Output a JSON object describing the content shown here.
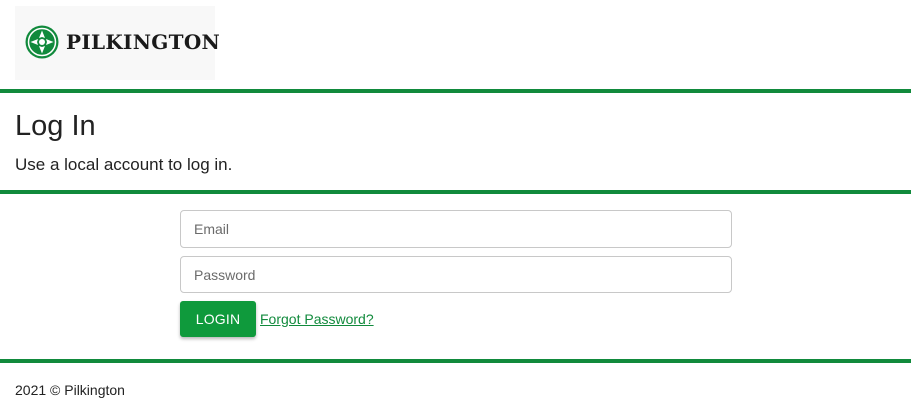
{
  "brand": {
    "name": "PILKINGTON",
    "logo_icon": "pilkington-emblem-icon",
    "accent_color": "#118a3c",
    "button_color": "#0f9a3c"
  },
  "page": {
    "title": "Log In",
    "subtitle": "Use a local account to log in."
  },
  "form": {
    "email_placeholder": "Email",
    "email_value": "",
    "password_placeholder": "Password",
    "password_value": "",
    "login_label": "LOGIN",
    "forgot_label": "Forgot Password?"
  },
  "footer": {
    "text": "2021 © Pilkington"
  }
}
